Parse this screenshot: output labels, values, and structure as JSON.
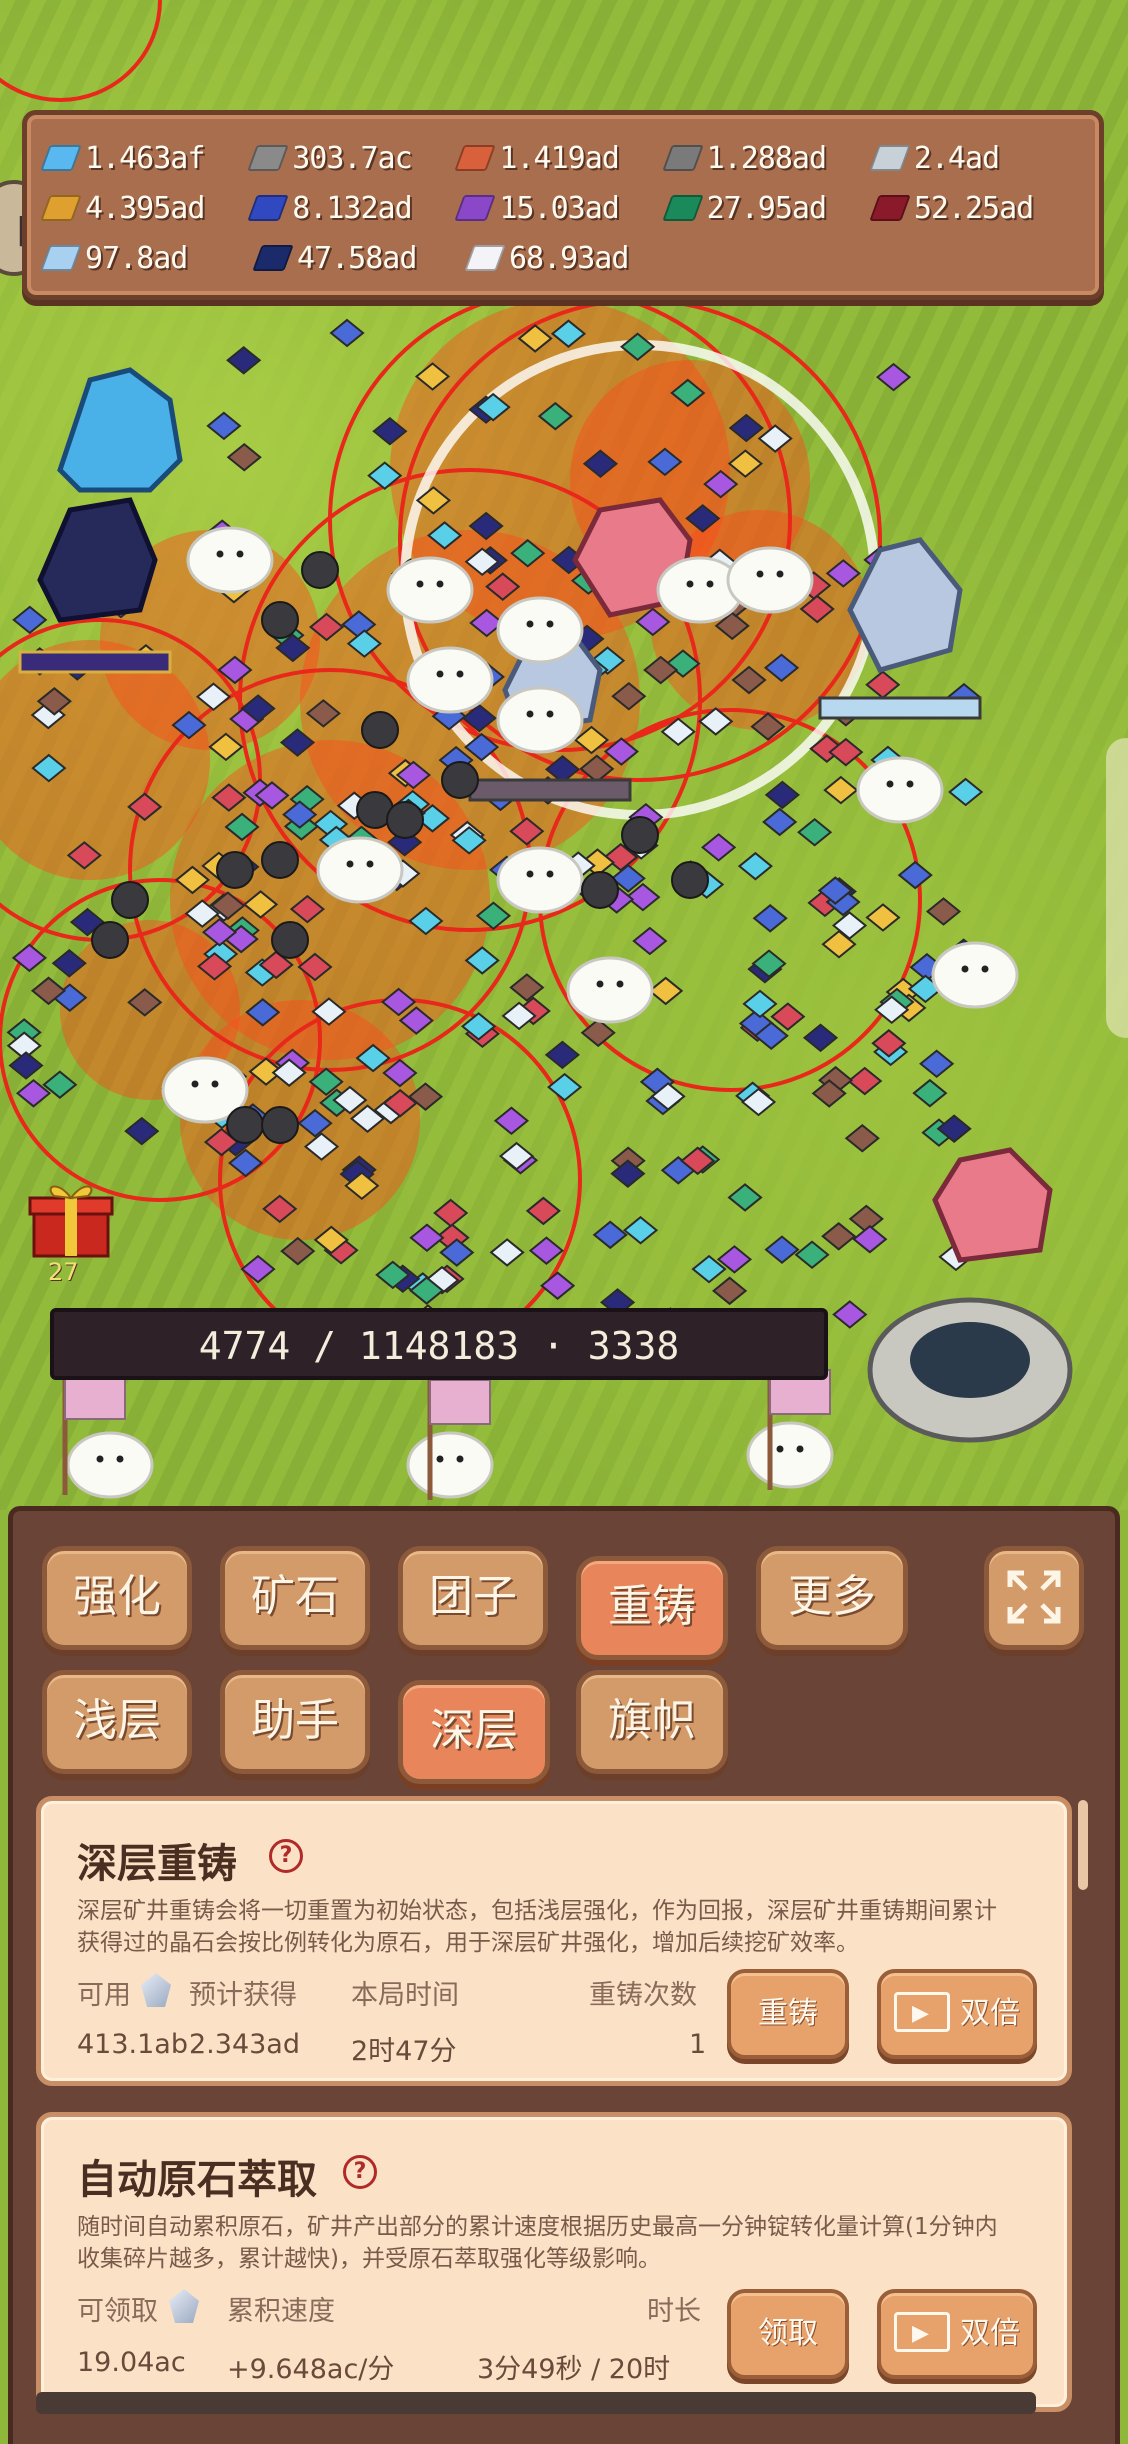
{
  "resources": [
    [
      {
        "value": "1.463af",
        "color": "#5ab8f0",
        "icon": "blue-crystal-icon"
      },
      {
        "value": "303.7ac",
        "color": "#8a8a8a",
        "icon": "stone-ingot-icon"
      },
      {
        "value": "1.419ad",
        "color": "#d8603a",
        "icon": "copper-ingot-icon"
      },
      {
        "value": "1.288ad",
        "color": "#7a7a7a",
        "icon": "iron-ingot-icon"
      },
      {
        "value": "2.4ad",
        "color": "#c8d0d8",
        "icon": "silver-ingot-icon"
      }
    ],
    [
      {
        "value": "4.395ad",
        "color": "#e0a030",
        "icon": "gold-ingot-icon"
      },
      {
        "value": "8.132ad",
        "color": "#3048c0",
        "icon": "sapphire-ingot-icon"
      },
      {
        "value": "15.03ad",
        "color": "#8a48c8",
        "icon": "amethyst-ingot-icon"
      },
      {
        "value": "27.95ad",
        "color": "#1a8a5a",
        "icon": "emerald-ingot-icon"
      },
      {
        "value": "52.25ad",
        "color": "#8a1a2a",
        "icon": "ruby-ingot-icon"
      }
    ],
    [
      {
        "value": "97.8ad",
        "color": "#a8d0f0",
        "icon": "diamond-ingot-icon"
      },
      {
        "value": "47.58ad",
        "color": "#1a2a6a",
        "icon": "dark-ingot-icon"
      },
      {
        "value": "68.93ad",
        "color": "#f4f4f8",
        "icon": "white-ingot-icon"
      }
    ]
  ],
  "field": {
    "progress_text": "4774 / 1148183 · 3338",
    "gift_count": "27"
  },
  "menu": {
    "tabs_row1": [
      {
        "label": "强化",
        "active": false
      },
      {
        "label": "矿石",
        "active": false
      },
      {
        "label": "团子",
        "active": false
      },
      {
        "label": "重铸",
        "active": true
      },
      {
        "label": "更多",
        "active": false
      }
    ],
    "tabs_row2": [
      {
        "label": "浅层",
        "active": false
      },
      {
        "label": "助手",
        "active": false
      },
      {
        "label": "深层",
        "active": true
      },
      {
        "label": "旗帜",
        "active": false
      }
    ]
  },
  "deep_recast": {
    "title": "深层重铸",
    "help": "?",
    "desc_line1": "深层矿井重铸会将一切重置为初始状态，包括浅层强化，作为回报，深层矿井重铸期间累计",
    "desc_line2": "获得过的晶石会按比例转化为原石，用于深层矿井强化，增加后续挖矿效率。",
    "label_available": "可用",
    "label_expected": "预计获得",
    "label_time": "本局时间",
    "label_count": "重铸次数",
    "value_available": "413.1ab",
    "value_expected": "2.343ad",
    "value_time": "2时47分",
    "value_count": "1",
    "button_recast": "重铸",
    "button_double": "双倍"
  },
  "auto_extract": {
    "title": "自动原石萃取",
    "help": "?",
    "desc_line1": "随时间自动累积原石，矿井产出部分的累计速度根据历史最高一分钟锭转化量计算(1分钟内",
    "desc_line2": "收集碎片越多，累计越快)，并受原石萃取强化等级影响。",
    "label_claimable": "可领取",
    "label_speed": "累积速度",
    "label_duration": "时长",
    "value_claimable": "19.04ac",
    "value_speed": "+9.648ac/分",
    "value_duration": "3分49秒 / 20时",
    "button_claim": "领取",
    "button_double": "双倍"
  }
}
